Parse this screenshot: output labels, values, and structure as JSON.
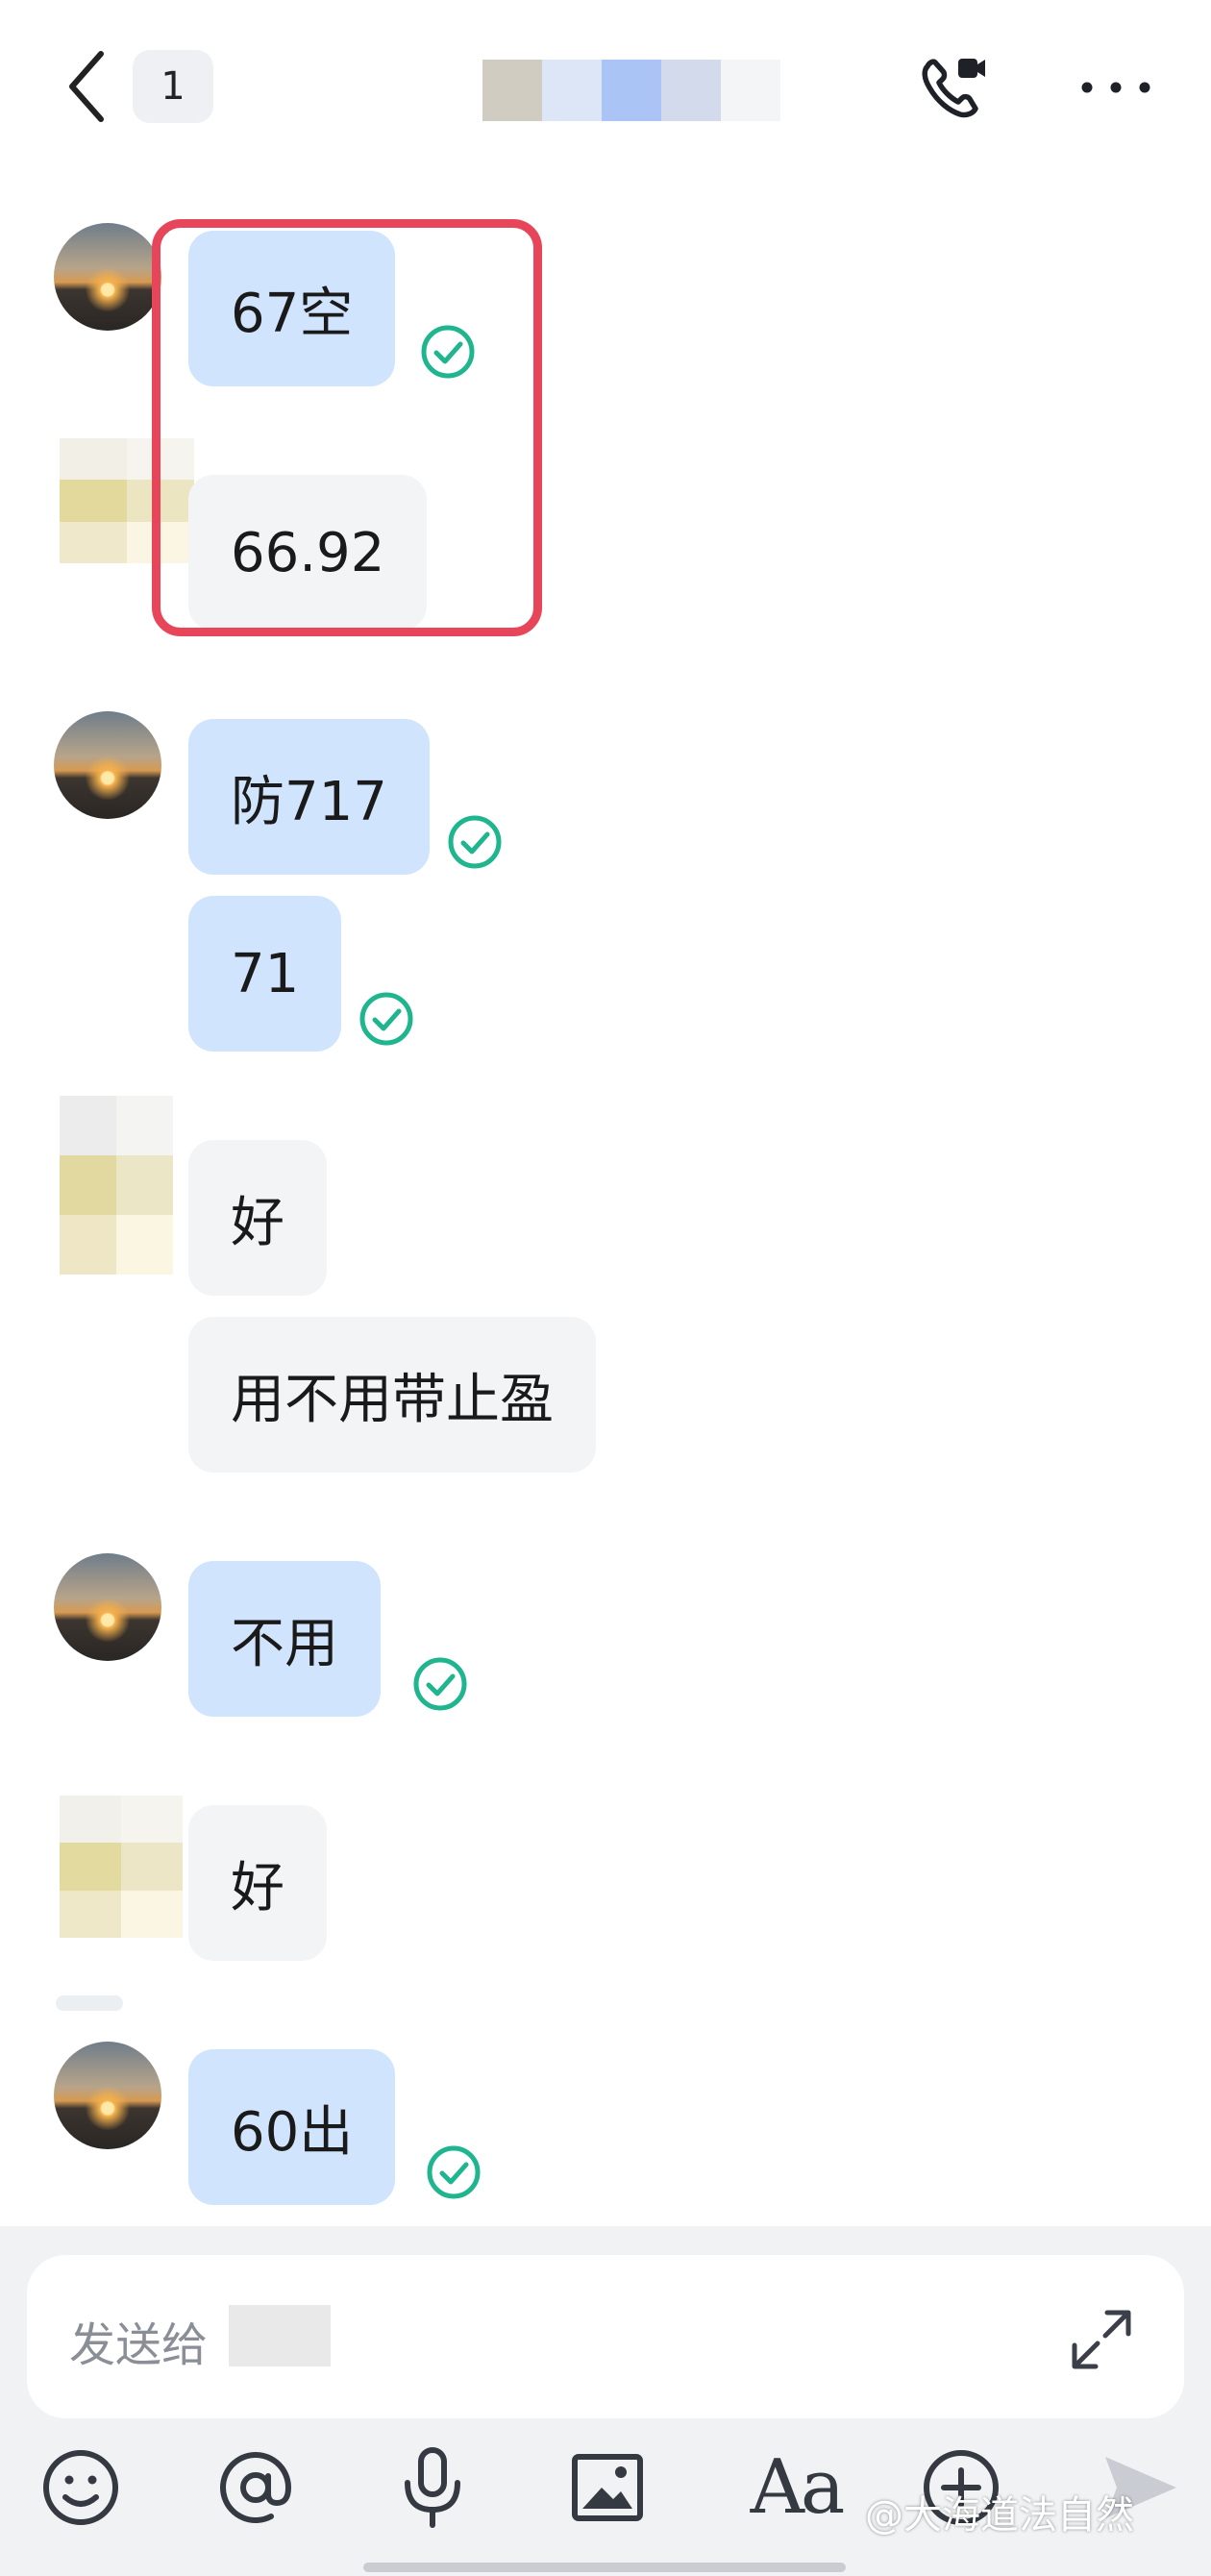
{
  "header": {
    "unread_count": "1",
    "icons": {
      "back": "chevron-left-icon",
      "call": "phone-video-icon",
      "more": "more-horizontal-icon"
    },
    "title_mosaic_colors": [
      "#d0ccc2",
      "#dde6f7",
      "#a9c4f5",
      "#d2daec",
      "#f4f5f7"
    ]
  },
  "messages": [
    {
      "sender": "me",
      "text": "67空",
      "read": true
    },
    {
      "sender": "them",
      "text": "66.92"
    },
    {
      "sender": "me",
      "text": "防717",
      "read": true
    },
    {
      "sender": "me",
      "text": "71",
      "read": true
    },
    {
      "sender": "them",
      "text": "好"
    },
    {
      "sender": "them",
      "text": "用不用带止盈"
    },
    {
      "sender": "me",
      "text": "不用",
      "read": true
    },
    {
      "sender": "them",
      "text": "好"
    },
    {
      "sender": "me",
      "text": "60出",
      "read": true
    }
  ],
  "colors": {
    "my_bubble": "#d1e4fe",
    "their_bubble": "#f3f4f6",
    "read_check": "#1fb58f",
    "highlight_box": "#e7465a"
  },
  "composer": {
    "placeholder": "发送给",
    "tools": [
      "emoji-icon",
      "at-mention-icon",
      "microphone-icon",
      "image-icon",
      "text-format-icon",
      "add-icon",
      "send-icon"
    ],
    "text_format_label": "Aa"
  },
  "watermark": "@大海道法自然"
}
